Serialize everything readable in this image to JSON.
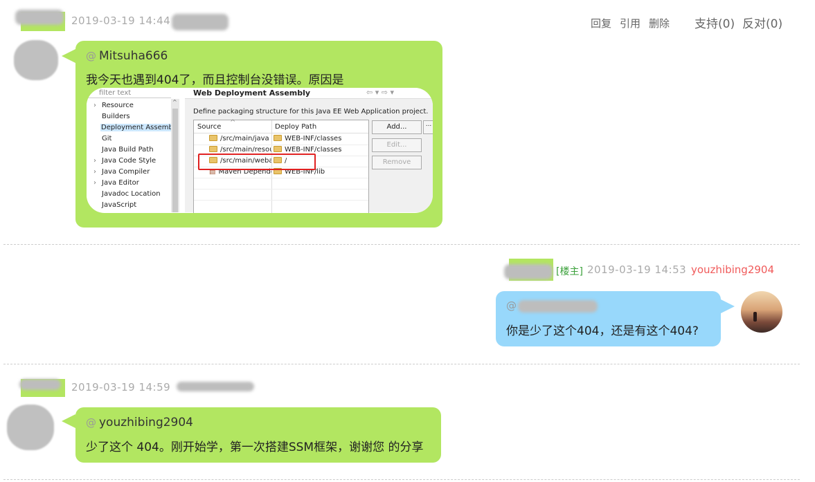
{
  "comment1": {
    "timestamp": "2019-03-19 14:44",
    "actions": {
      "reply": "回复",
      "quote": "引用",
      "delete": "删除"
    },
    "votes": {
      "support": "支持(0)",
      "oppose": "反对(0)"
    },
    "reply_to": "Mitsuha666",
    "message": "我今天也遇到404了，而且控制台没错误。原因是",
    "screenshot": {
      "filter_placeholder": "filter text",
      "tree": [
        "Resource",
        "Builders",
        "Deployment Assembly",
        "Git",
        "Java Build Path",
        "Java Code Style",
        "Java Compiler",
        "Java Editor",
        "Javadoc Location",
        "JavaScript"
      ],
      "panel_title": "Web Deployment Assembly",
      "description": "Define packaging structure for this Java EE Web Application project.",
      "col_source": "Source",
      "col_deploy": "Deploy Path",
      "rows": [
        {
          "source": "/src/main/java",
          "deploy": "WEB-INF/classes"
        },
        {
          "source": "/src/main/resou",
          "deploy": "WEB-INF/classes"
        },
        {
          "source": "/src/main/webap",
          "deploy": "/"
        },
        {
          "source": "Maven Depende",
          "deploy": "WEB-INF/lib"
        }
      ],
      "buttons": {
        "add": "Add...",
        "edit": "Edit...",
        "remove": "Remove"
      },
      "highlight_color": "#e02020"
    }
  },
  "comment2": {
    "host_tag": "[楼主]",
    "timestamp": "2019-03-19 14:53",
    "author": "youzhibing2904",
    "message": "你是少了这个404，还是有这个404?"
  },
  "comment3": {
    "timestamp": "2019-03-19 14:59",
    "reply_to": "youzhibing2904",
    "message": "少了这个 404。刚开始学，第一次搭建SSM框架，谢谢您 的分享"
  },
  "at_symbol": "@",
  "colors": {
    "green_bubble": "#b2e661",
    "blue_bubble": "#98d8fb",
    "author_red": "#f05a5a",
    "host_green": "#3aa03a"
  }
}
